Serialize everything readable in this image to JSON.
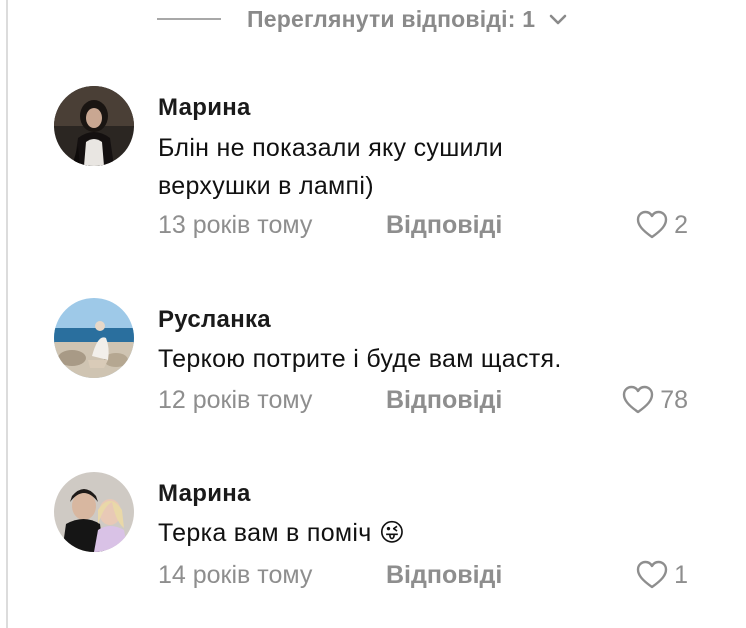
{
  "replies_toggle": {
    "label": "Переглянути відповіді: 1",
    "icon": "chevron-down-icon"
  },
  "comments": [
    {
      "author": "Марина",
      "text_lines": [
        "Блін не показали яку сушили",
        "верхушки в лампі)"
      ],
      "time": "13 років тому",
      "reply_label": "Відповіді",
      "likes": "2"
    },
    {
      "author": "Русланка",
      "text_lines": [
        "Теркою потрите і буде вам щастя."
      ],
      "time": "12 років тому",
      "reply_label": "Відповіді",
      "likes": "78"
    },
    {
      "author": "Марина",
      "text_lines": [
        "Терка вам в поміч 😜"
      ],
      "time": "14 років тому",
      "reply_label": "Відповіді",
      "likes": "1"
    }
  ],
  "colors": {
    "text": "#111111",
    "muted": "#8e8e8e",
    "rule": "#dcdcdc"
  }
}
